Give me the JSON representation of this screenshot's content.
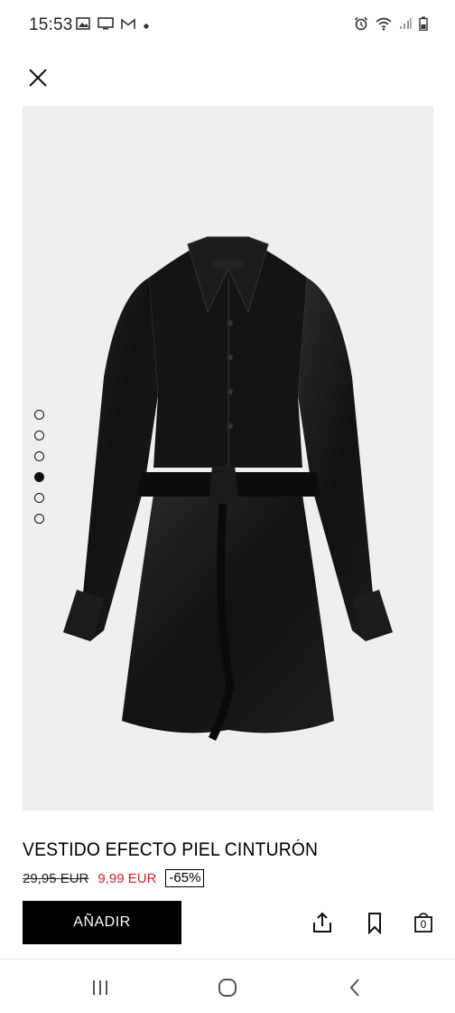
{
  "status_bar": {
    "time": "15:53",
    "icons_left": [
      "image-icon",
      "cast-icon",
      "gmail-icon",
      "dot-icon"
    ],
    "icons_right": [
      "alarm-icon",
      "wifi-icon",
      "signal-icon",
      "battery-icon"
    ]
  },
  "product": {
    "image_name": "black faux leather shirt dress with belt",
    "gallery_count": 6,
    "gallery_active_index": 3,
    "title": "VESTIDO EFECTO PIEL CINTURÓN",
    "old_price": "29,95 EUR",
    "new_price": "9,99 EUR",
    "discount": "-65%",
    "sale_color": "#d8232a"
  },
  "actions": {
    "add_label": "AÑADIR",
    "share_icon": "share-icon",
    "save_icon": "bookmark-icon",
    "bag_icon": "shopping-bag-icon",
    "bag_count": "0"
  },
  "navbar": {
    "items": [
      "recent-apps-icon",
      "home-icon",
      "back-icon"
    ]
  }
}
